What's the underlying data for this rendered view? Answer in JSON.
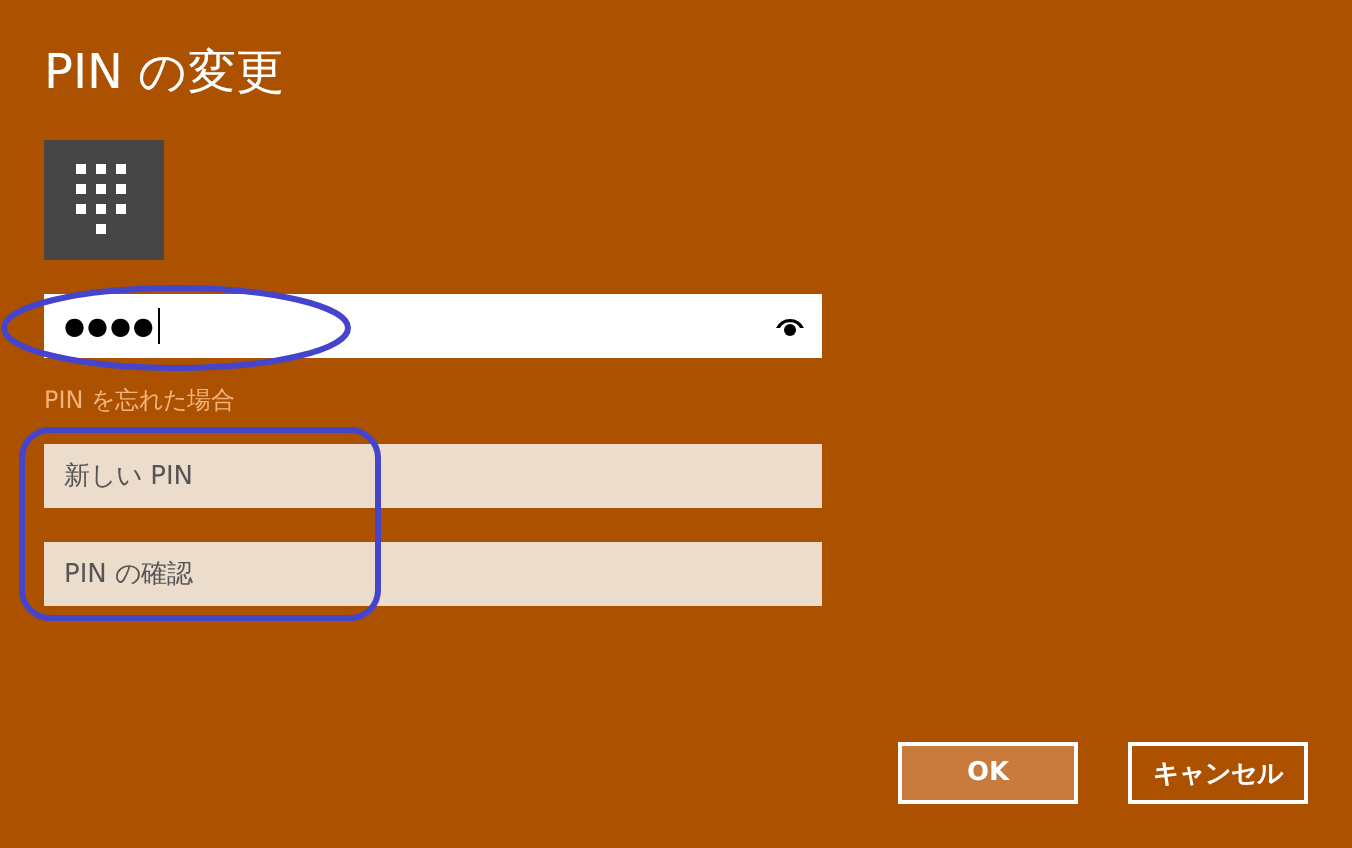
{
  "dialog": {
    "title": "PIN の変更"
  },
  "current_pin": {
    "value": "●●●●",
    "reveal_button": true
  },
  "forgot_link": "PIN を忘れた場合",
  "new_pin": {
    "placeholder": "新しい PIN"
  },
  "confirm_pin": {
    "placeholder": "PIN の確認"
  },
  "buttons": [
    {
      "label": "OK",
      "kind": "primary"
    },
    {
      "label": "キャンセル",
      "kind": "secondary"
    }
  ]
}
